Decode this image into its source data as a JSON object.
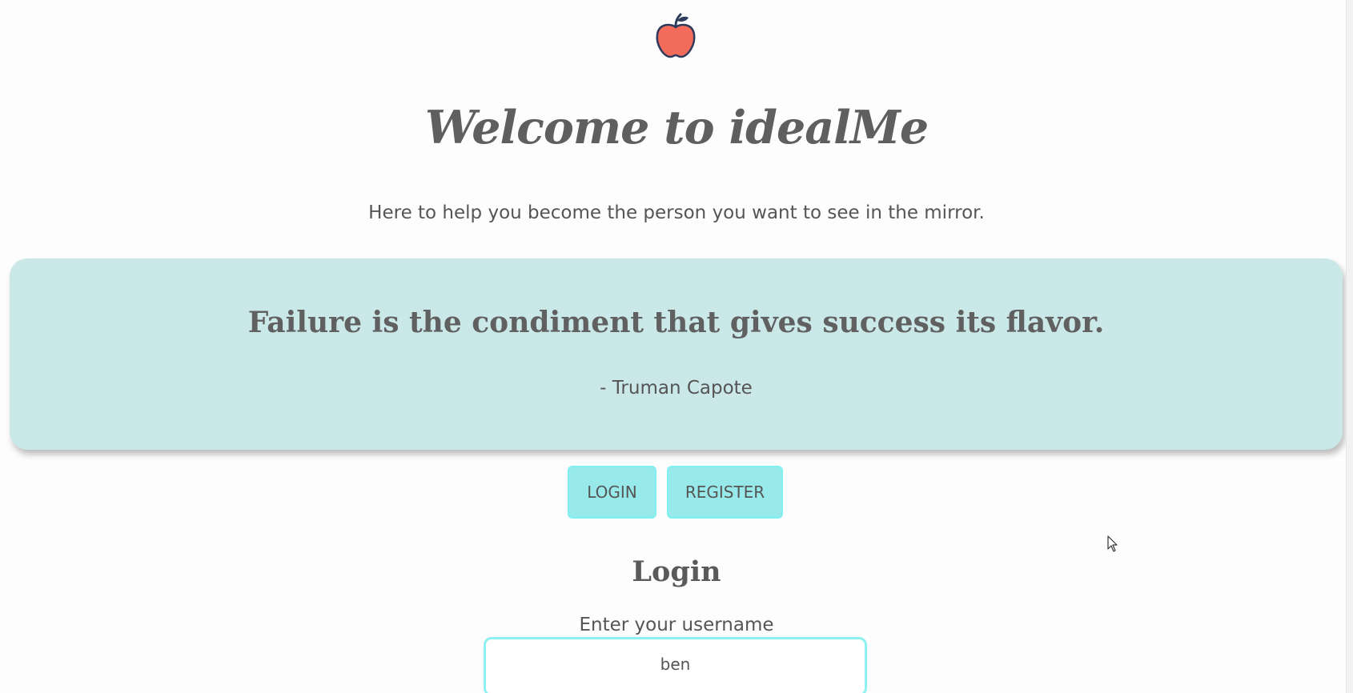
{
  "header": {
    "logo_icon": "apple-icon",
    "title": "Welcome to idealMe",
    "tagline": "Here to help you become the person you want to see in the mirror."
  },
  "quote": {
    "text": "Failure is the condiment that gives success its flavor.",
    "author": "- Truman Capote"
  },
  "auth_buttons": {
    "login_label": "LOGIN",
    "register_label": "REGISTER"
  },
  "login_form": {
    "heading": "Login",
    "username_label": "Enter your username",
    "username_value": "ben"
  },
  "colors": {
    "quote_background": "#cbe8e8",
    "button_background": "#98eaea",
    "input_border": "#8ef0f0",
    "apple_red": "#f26b5b",
    "text": "#5a5a5a"
  }
}
